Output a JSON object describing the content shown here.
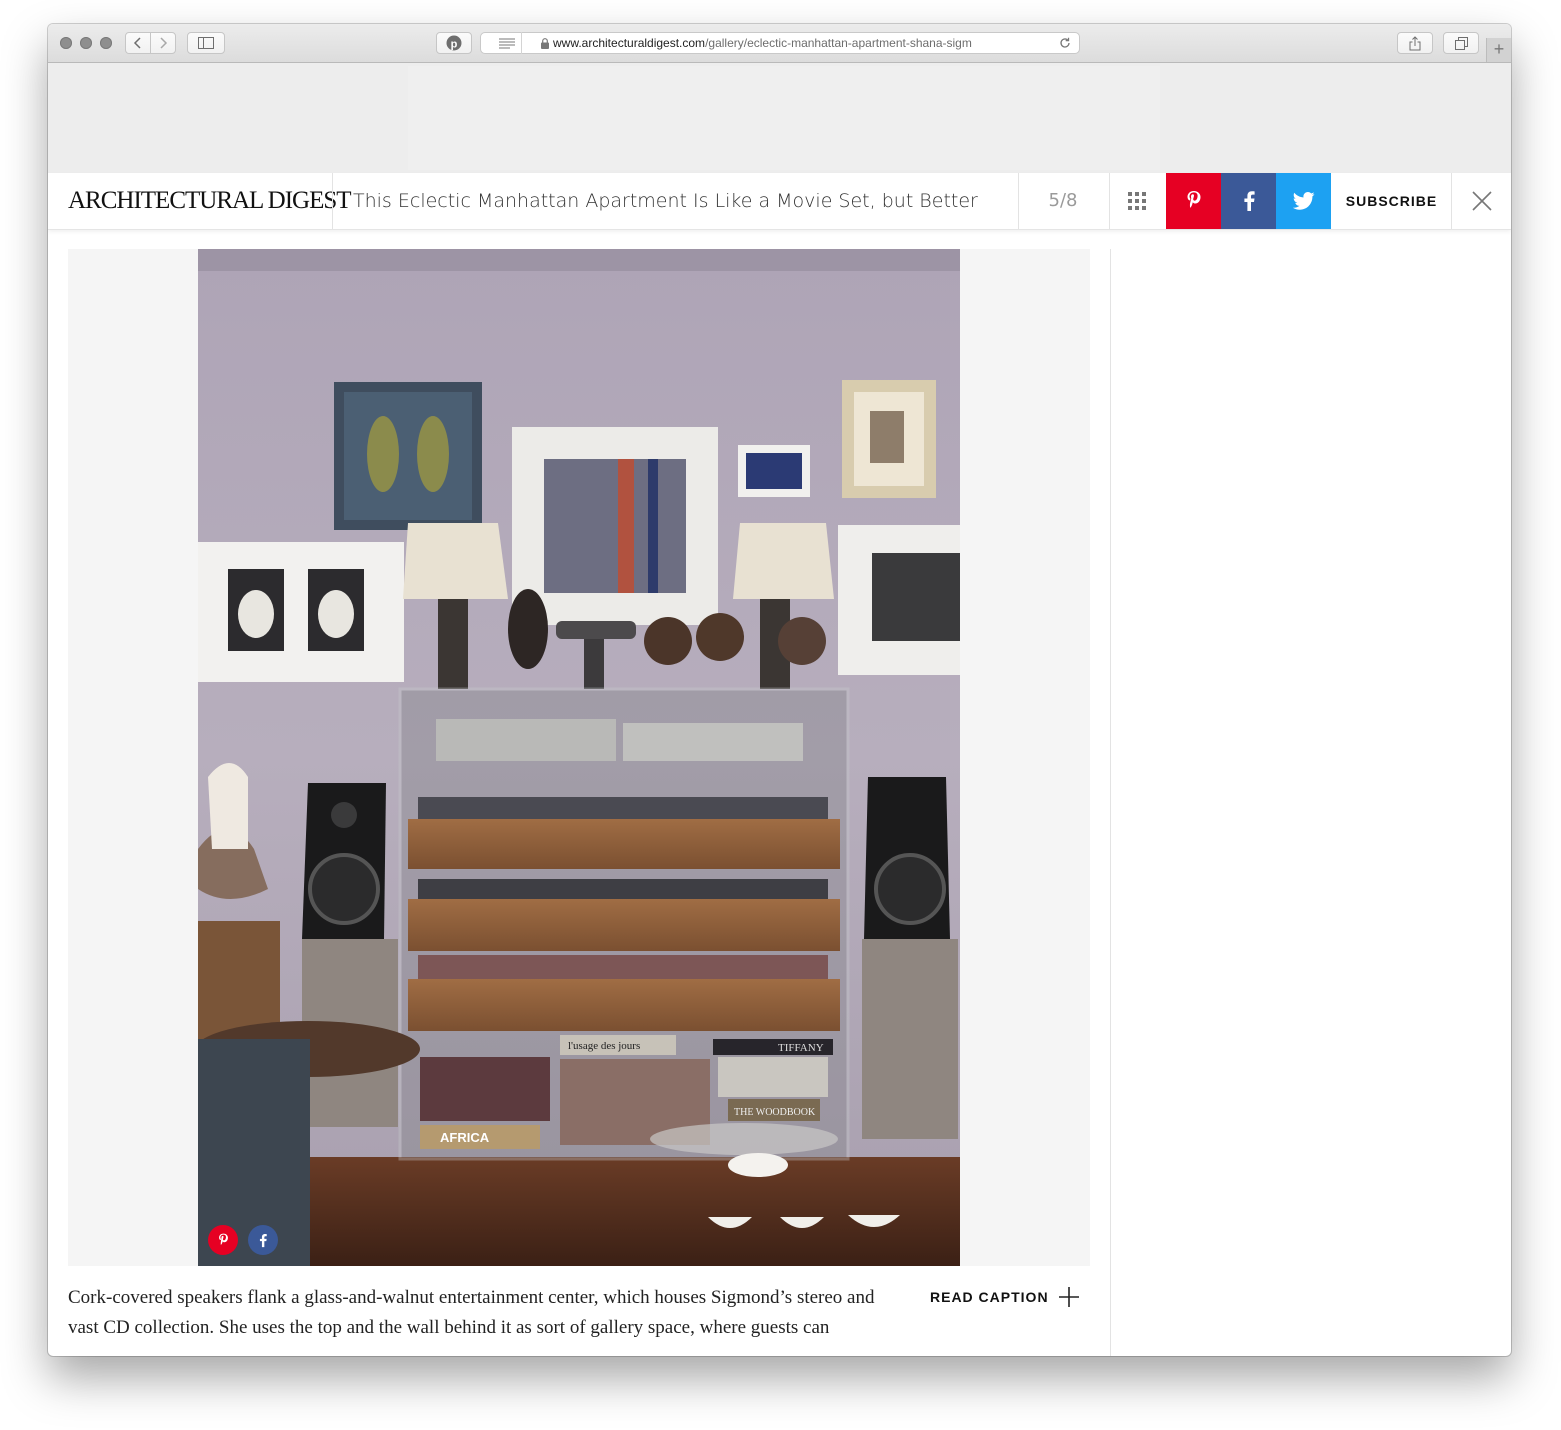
{
  "browser": {
    "url_domain": "www.architecturaldigest.com",
    "url_path": "/gallery/eclectic-manhattan-apartment-shana-sigm"
  },
  "header": {
    "logo": "ARCHITECTURAL DIGEST",
    "gallery_title": "This Eclectic Manhattan Apartment Is Like a Movie Set, but Better",
    "counter": "5/8",
    "subscribe_label": "SUBSCRIBE"
  },
  "colors": {
    "pinterest": "#e60023",
    "facebook": "#3b5998",
    "twitter": "#1da1f2"
  },
  "photo": {
    "book_labels": [
      "l'usage des jours",
      "TIFFANY",
      "AFRICA",
      "THE WOODBOOK"
    ]
  },
  "caption": {
    "text": "Cork-covered speakers flank a glass-and-walnut entertainment center, which houses Sigmond’s stereo and vast CD collection. She uses the top and the wall behind it as sort of gallery space, where guests can",
    "read_caption_label": "READ CAPTION"
  }
}
